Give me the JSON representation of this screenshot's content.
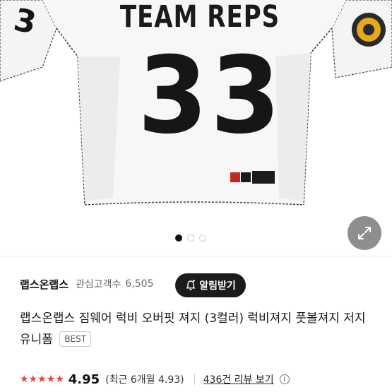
{
  "product_image": {
    "jersey_title": "TEAM REPS",
    "jersey_number": "33",
    "sleeve_number": "3",
    "carousel_total": 3,
    "carousel_active": 1
  },
  "brand": {
    "name": "랩스온랩스",
    "follower_label": "관심고객수",
    "follower_count": "6,505",
    "alert_button": "알림받기"
  },
  "product": {
    "title": "랩스온랩스 짐웨어 럭비 오버핏 져지 (3컬러) 럭비져지 풋볼져지 저지 유니폼",
    "badge": "BEST"
  },
  "rating": {
    "stars": "★★★★★",
    "score": "4.95",
    "recent": "(최근 6개월 4.93)",
    "review_link": "436건 리뷰 보기"
  },
  "colors": {
    "star": "#e0463f",
    "alert_bg": "#1b1b1b",
    "expand_bg": "#8e8e8e"
  }
}
